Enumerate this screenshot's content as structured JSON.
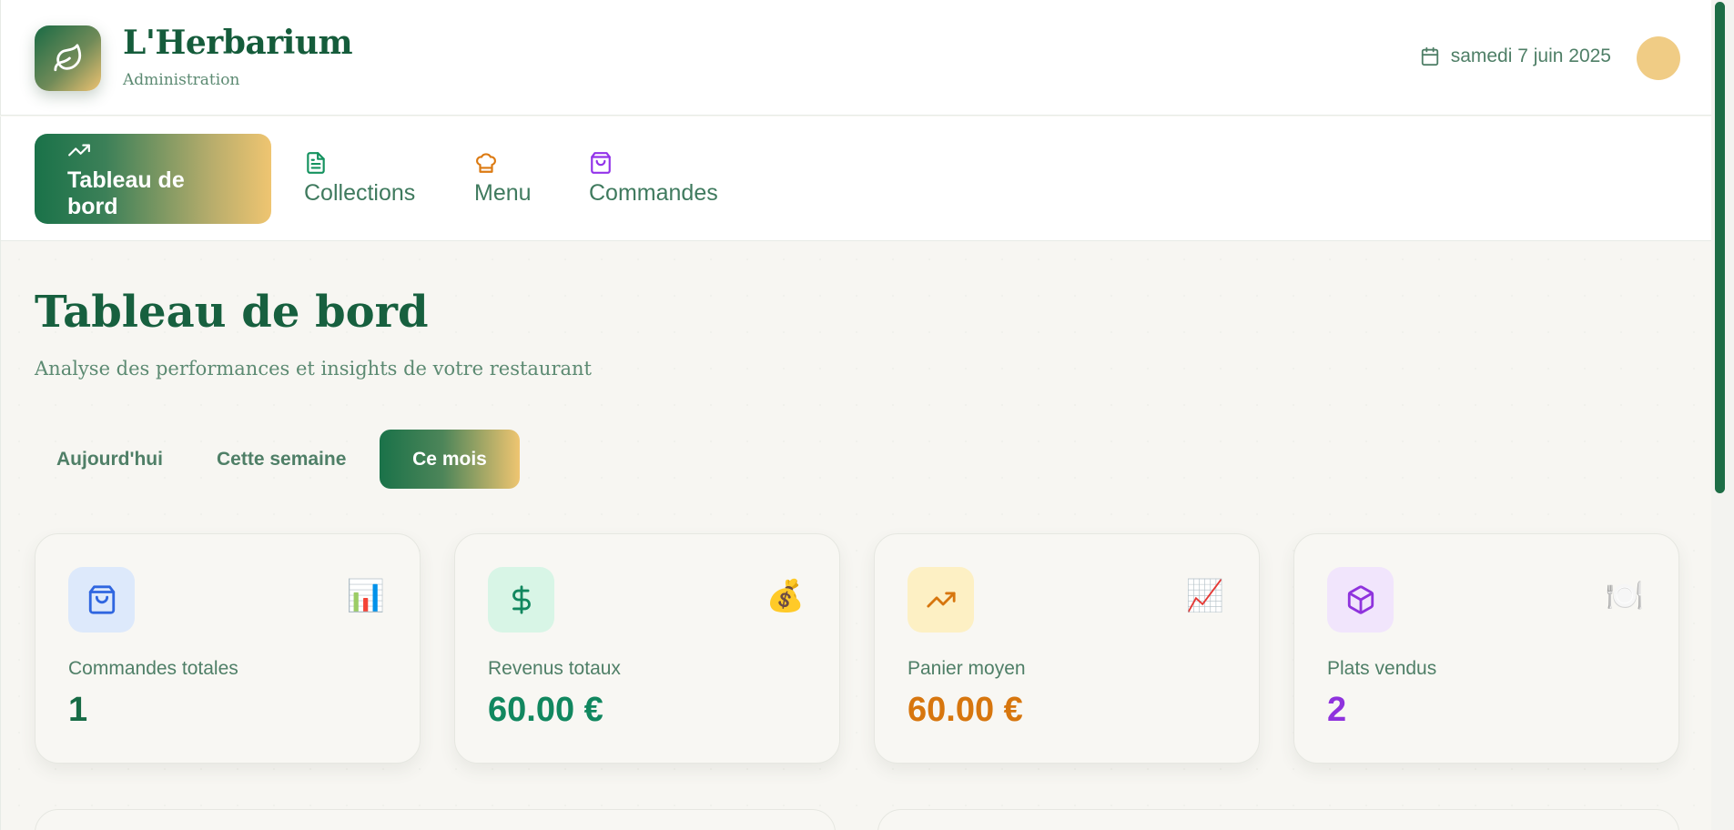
{
  "header": {
    "brand_title": "L'Herbarium",
    "brand_subtitle": "Administration",
    "logo_icon": "leaf-icon",
    "date": "samedi 7 juin 2025",
    "date_icon": "calendar-icon"
  },
  "nav": {
    "items": [
      {
        "label": "Tableau de bord",
        "icon": "trending-up-icon",
        "active": true
      },
      {
        "label": "Collections",
        "icon": "document-icon",
        "active": false
      },
      {
        "label": "Menu",
        "icon": "chef-hat-icon",
        "active": false
      },
      {
        "label": "Commandes",
        "icon": "shopping-bag-icon",
        "active": false
      }
    ]
  },
  "page": {
    "title": "Tableau de bord",
    "subtitle": "Analyse des performances et insights de votre restaurant"
  },
  "periods": [
    {
      "label": "Aujourd'hui",
      "active": false
    },
    {
      "label": "Cette semaine",
      "active": false
    },
    {
      "label": "Ce mois",
      "active": true
    }
  ],
  "stats": [
    {
      "label": "Commandes totales",
      "value": "1",
      "icon": "shopping-bag-icon",
      "emoji": "📊",
      "color": "#176b45",
      "tile_bg": "#dde9fb"
    },
    {
      "label": "Revenus totaux",
      "value": "60.00 €",
      "icon": "dollar-icon",
      "emoji": "💰",
      "color": "#11875f",
      "tile_bg": "#d8f5e6"
    },
    {
      "label": "Panier moyen",
      "value": "60.00 €",
      "icon": "trending-up-icon",
      "emoji": "📈",
      "color": "#d7760e",
      "tile_bg": "#fdf0c4"
    },
    {
      "label": "Plats vendus",
      "value": "2",
      "icon": "package-icon",
      "emoji": "🍽️",
      "color": "#8f33dd",
      "tile_bg": "#f1e5fc"
    }
  ],
  "colors": {
    "brand_green": "#176b45",
    "brand_gold": "#efc571",
    "scroll_thumb": "#1d6d46"
  }
}
